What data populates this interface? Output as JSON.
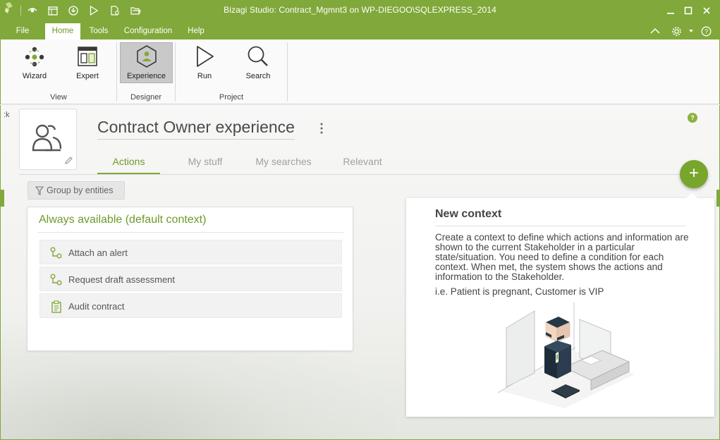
{
  "window": {
    "title": "Bizagi Studio: Contract_Mgmnt3  on WP-DIEGOO\\SQLEXPRESS_2014"
  },
  "menu": {
    "tabs": [
      {
        "label": "File"
      },
      {
        "label": "Home"
      },
      {
        "label": "Tools"
      },
      {
        "label": "Configuration"
      },
      {
        "label": "Help"
      }
    ]
  },
  "ribbon": {
    "buttons": [
      {
        "label": "Wizard"
      },
      {
        "label": "Expert"
      },
      {
        "label": "Experience"
      },
      {
        "label": "Run"
      },
      {
        "label": "Search"
      }
    ],
    "groups": [
      {
        "label": "View"
      },
      {
        "label": "Designer"
      },
      {
        "label": "Project"
      }
    ]
  },
  "page": {
    "cut_label": ":k",
    "title": "Contract Owner experience",
    "help_label": "?",
    "tabs": [
      {
        "label": "Actions"
      },
      {
        "label": "My stuff"
      },
      {
        "label": "My searches"
      },
      {
        "label": "Relevant"
      }
    ],
    "fab_label": "+",
    "group_button": "Group by entities"
  },
  "card": {
    "title": "Always available (default context)",
    "actions": [
      {
        "label": "Attach an alert",
        "icon": "process-icon"
      },
      {
        "label": "Request draft assessment",
        "icon": "process-icon"
      },
      {
        "label": "Audit contract",
        "icon": "clipboard-icon"
      }
    ]
  },
  "context": {
    "title": "New context",
    "description": "Create a context to define which actions and information are shown to the current Stakeholder in a particular state/situation. You need to define a condition for each context. When met, the system shows the actions and information to the Stakeholder.",
    "example": "i.e. Patient is pregnant, Customer is VIP"
  },
  "colors": {
    "accent": "#80a83a",
    "accent_dark": "#6e9a2a"
  }
}
